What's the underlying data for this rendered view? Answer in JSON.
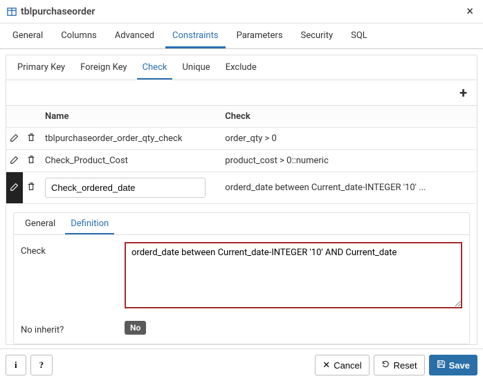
{
  "title": "tblpurchaseorder",
  "tabs1": [
    "General",
    "Columns",
    "Advanced",
    "Constraints",
    "Parameters",
    "Security",
    "SQL"
  ],
  "tabs1_active": 3,
  "tabs2": [
    "Primary Key",
    "Foreign Key",
    "Check",
    "Unique",
    "Exclude"
  ],
  "tabs2_active": 2,
  "table": {
    "headers": {
      "name": "Name",
      "check": "Check"
    },
    "rows": [
      {
        "name": "tblpurchaseorder_order_qty_check",
        "check": "order_qty > 0",
        "editing": false
      },
      {
        "name": "Check_Product_Cost",
        "check": "product_cost > 0::numeric",
        "editing": false
      },
      {
        "name": "Check_ordered_date",
        "check": "orderd_date between Current_date-INTEGER '10' ...",
        "editing": true
      }
    ]
  },
  "detail": {
    "tabs": [
      "General",
      "Definition"
    ],
    "active": 1,
    "check_label": "Check",
    "check_value": "orderd_date between Current_date-INTEGER '10' AND Current_date",
    "no_inherit_label": "No inherit?",
    "no_inherit_value": "No"
  },
  "footer": {
    "info": "i",
    "help": "?",
    "cancel": "Cancel",
    "reset": "Reset",
    "save": "Save"
  }
}
